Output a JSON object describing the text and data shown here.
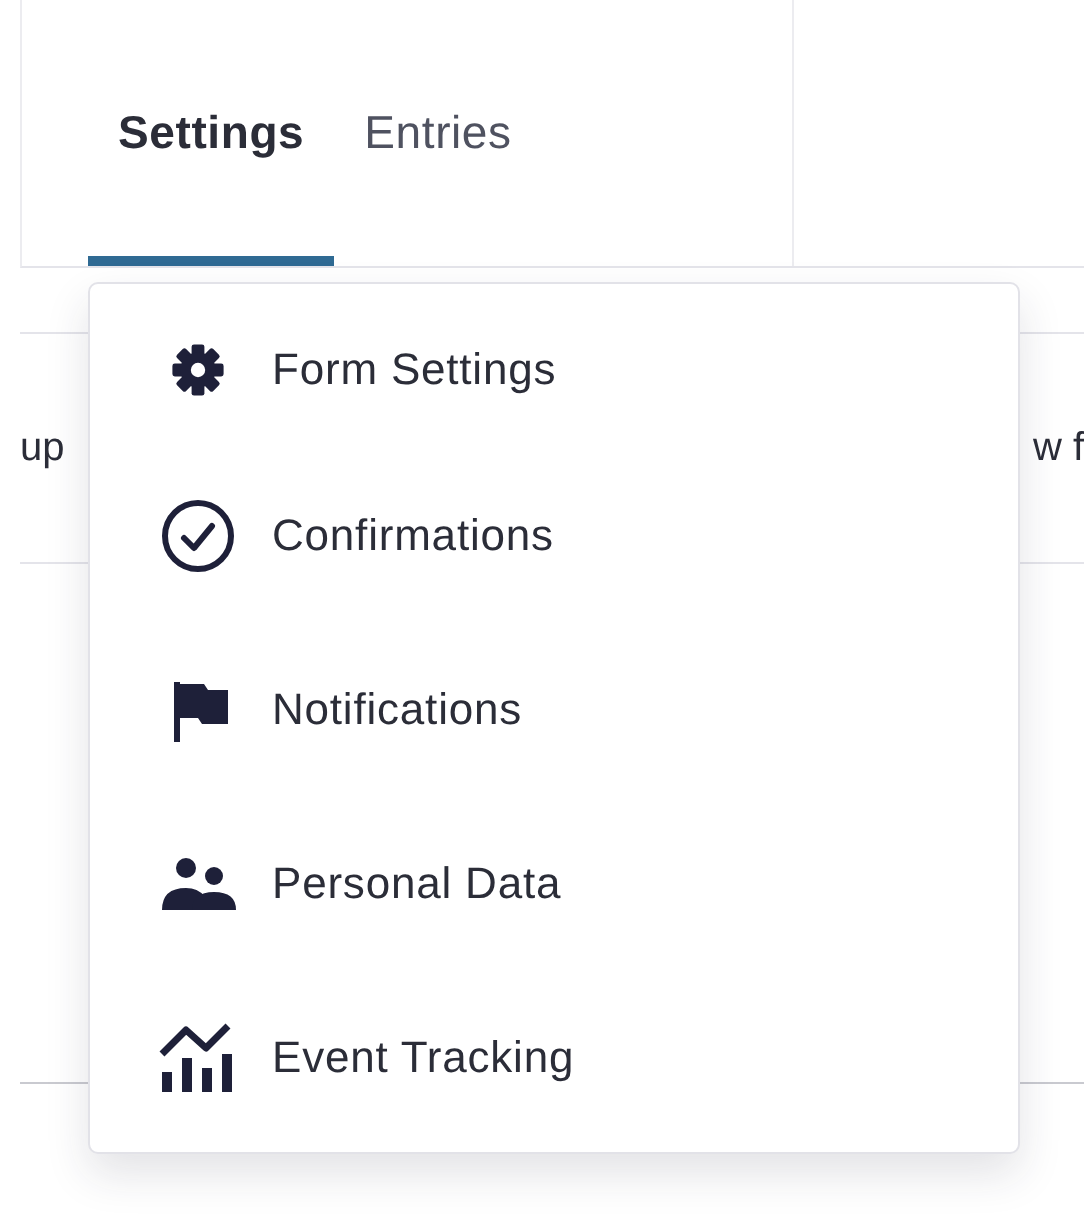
{
  "tabs": [
    {
      "label": "Settings",
      "selected": true
    },
    {
      "label": "Entries",
      "selected": false
    }
  ],
  "toolbar": {
    "left_text": "up",
    "right_text": "w f"
  },
  "menu": {
    "items": [
      {
        "label": "Form Settings"
      },
      {
        "label": "Confirmations"
      },
      {
        "label": "Notifications"
      },
      {
        "label": "Personal Data"
      },
      {
        "label": "Event Tracking"
      }
    ]
  }
}
